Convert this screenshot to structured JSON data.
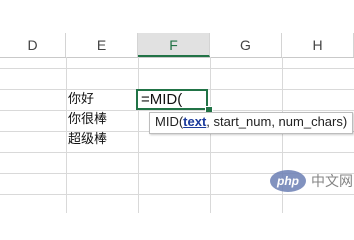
{
  "columns": [
    "D",
    "E",
    "F",
    "G",
    "H"
  ],
  "active_column": "F",
  "cells": {
    "e1": "你好",
    "e2": "你很棒",
    "e3": "超级棒",
    "f1_formula": "=MID("
  },
  "tooltip": {
    "func": "MID(",
    "current_arg": "text",
    "rest": ", start_num, num_chars)"
  },
  "watermark": {
    "logo": "php",
    "text": "中文网"
  },
  "colors": {
    "accent": "#217346",
    "tooltip_arg": "#1b3a9b"
  }
}
